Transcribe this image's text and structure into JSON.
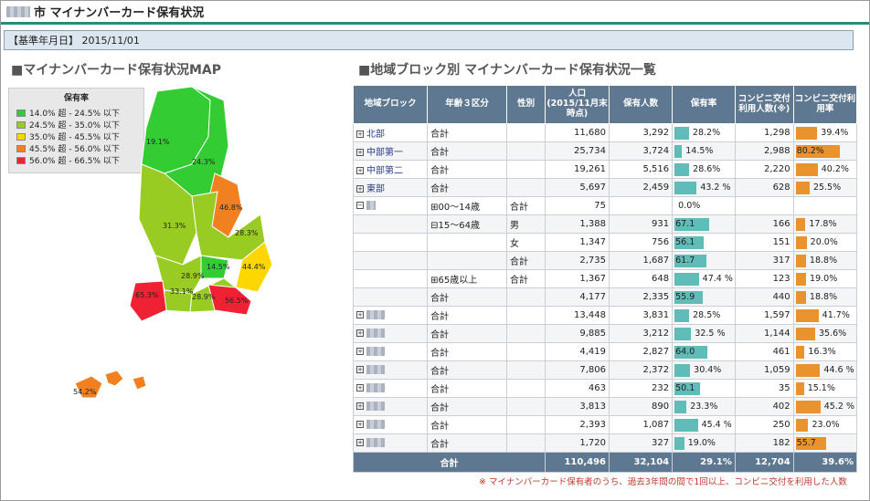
{
  "header": {
    "title_suffix": "市 マイナンバーカード保有状況"
  },
  "date_label": "【基準年月日】 2015/11/01",
  "sections": {
    "map": "■マイナンバーカード保有状況MAP",
    "table": "■地域ブロック別 マイナンバーカード保有状況一覧"
  },
  "legend": {
    "title": "保有率",
    "items": [
      {
        "label": "14.0% 超 - 24.5% 以下",
        "color": "#33cc33"
      },
      {
        "label": "24.5% 超 - 35.0% 以下",
        "color": "#99cc22"
      },
      {
        "label": "35.0% 超 - 45.5% 以下",
        "color": "#ffd700"
      },
      {
        "label": "45.5% 超 - 56.0% 以下",
        "color": "#f08020"
      },
      {
        "label": "56.0% 超 - 66.5% 以下",
        "color": "#ee2233"
      }
    ]
  },
  "map_labels": [
    "19.1%",
    "24.3%",
    "46.8%",
    "31.3%",
    "28.3%",
    "44.4%",
    "14.5%",
    "28.9%",
    "33.1%",
    "28.9%",
    "65.3%",
    "56.5%",
    "54.2%"
  ],
  "columns": [
    "地域ブロック",
    "年齢３区分",
    "性別",
    "人口\n(2015/11月末時点)",
    "保有人数",
    "保有率",
    "コンビニ交付利用人数(※)",
    "コンビニ交付利用率"
  ],
  "rows": [
    {
      "region": "北部",
      "age": "合計",
      "sex": "",
      "pop": "11,680",
      "holders": "3,292",
      "rate": "28.2%",
      "rv": 28.2,
      "conv": "1,298",
      "crate": "39.4%",
      "cv": 39.4
    },
    {
      "region": "中部第一",
      "age": "合計",
      "sex": "",
      "pop": "25,734",
      "holders": "3,724",
      "rate": "14.5%",
      "rv": 14.5,
      "conv": "2,988",
      "crate": "80.2%",
      "cv": 80.2
    },
    {
      "region": "中部第二",
      "age": "合計",
      "sex": "",
      "pop": "19,261",
      "holders": "5,516",
      "rate": "28.6%",
      "rv": 28.6,
      "conv": "2,220",
      "crate": "40.2%",
      "cv": 40.2
    },
    {
      "region": "東部",
      "age": "合計",
      "sex": "",
      "pop": "5,697",
      "holders": "2,459",
      "rate": "43.2 %",
      "rv": 43.2,
      "conv": "628",
      "crate": "25.5%",
      "cv": 25.5
    },
    {
      "region": "",
      "age": "⊞00～14歳",
      "sex": "合計",
      "pop": "75",
      "holders": "",
      "rate": "0.0%",
      "rv": 0,
      "conv": "",
      "crate": "",
      "cv": 0
    },
    {
      "region": "",
      "age": "⊟15～64歳",
      "sex": "男",
      "pop": "1,388",
      "holders": "931",
      "rate": "67.1",
      "rv": 67.1,
      "conv": "166",
      "crate": "17.8%",
      "cv": 17.8
    },
    {
      "region": "",
      "age": "",
      "sex": "女",
      "pop": "1,347",
      "holders": "756",
      "rate": "56.1",
      "rv": 56.1,
      "conv": "151",
      "crate": "20.0%",
      "cv": 20.0
    },
    {
      "region": "",
      "age": "",
      "sex": "合計",
      "pop": "2,735",
      "holders": "1,687",
      "rate": "61.7",
      "rv": 61.7,
      "conv": "317",
      "crate": "18.8%",
      "cv": 18.8
    },
    {
      "region": "",
      "age": "⊞65歳以上",
      "sex": "合計",
      "pop": "1,367",
      "holders": "648",
      "rate": "47.4 %",
      "rv": 47.4,
      "conv": "123",
      "crate": "19.0%",
      "cv": 19.0
    },
    {
      "region": "",
      "age": "合計",
      "sex": "",
      "pop": "4,177",
      "holders": "2,335",
      "rate": "55.9",
      "rv": 55.9,
      "conv": "440",
      "crate": "18.8%",
      "cv": 18.8
    },
    {
      "region": "",
      "age": "合計",
      "sex": "",
      "pop": "13,448",
      "holders": "3,831",
      "rate": "28.5%",
      "rv": 28.5,
      "conv": "1,597",
      "crate": "41.7%",
      "cv": 41.7
    },
    {
      "region": "",
      "age": "合計",
      "sex": "",
      "pop": "9,885",
      "holders": "3,212",
      "rate": "32.5 %",
      "rv": 32.5,
      "conv": "1,144",
      "crate": "35.6%",
      "cv": 35.6
    },
    {
      "region": "",
      "age": "合計",
      "sex": "",
      "pop": "4,419",
      "holders": "2,827",
      "rate": "64.0",
      "rv": 64.0,
      "conv": "461",
      "crate": "16.3%",
      "cv": 16.3
    },
    {
      "region": "",
      "age": "合計",
      "sex": "",
      "pop": "7,806",
      "holders": "2,372",
      "rate": "30.4%",
      "rv": 30.4,
      "conv": "1,059",
      "crate": "44.6 %",
      "cv": 44.6
    },
    {
      "region": "",
      "age": "合計",
      "sex": "",
      "pop": "463",
      "holders": "232",
      "rate": "50.1",
      "rv": 50.1,
      "conv": "35",
      "crate": "15.1%",
      "cv": 15.1
    },
    {
      "region": "",
      "age": "合計",
      "sex": "",
      "pop": "3,813",
      "holders": "890",
      "rate": "23.3%",
      "rv": 23.3,
      "conv": "402",
      "crate": "45.2 %",
      "cv": 45.2
    },
    {
      "region": "",
      "age": "合計",
      "sex": "",
      "pop": "2,393",
      "holders": "1,087",
      "rate": "45.4 %",
      "rv": 45.4,
      "conv": "250",
      "crate": "23.0%",
      "cv": 23.0
    },
    {
      "region": "",
      "age": "合計",
      "sex": "",
      "pop": "1,720",
      "holders": "327",
      "rate": "19.0%",
      "rv": 19.0,
      "conv": "182",
      "crate": "55.7",
      "cv": 55.7
    }
  ],
  "total": {
    "label": "合計",
    "pop": "110,496",
    "holders": "32,104",
    "rate": "29.1%",
    "conv": "12,704",
    "crate": "39.6%"
  },
  "footnote": "※ マイナンバーカード保有者のうち、過去3年間の間で1回以上、コンビニ交付を利用した人数"
}
